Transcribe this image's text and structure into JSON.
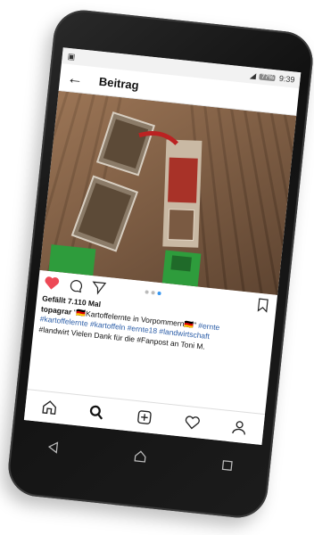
{
  "status_bar": {
    "time": "9:39",
    "battery": "77%"
  },
  "app_bar": {
    "title": "Beitrag"
  },
  "post": {
    "likes": "Gefällt 7.110 Mal",
    "username": "topagrar",
    "caption": "\"🇩🇪Kartoffelernte in Vorpommern🇩🇪\" ",
    "hashtags_line1": "#ernte",
    "hashtags_line2": "#kartoffelernte #kartoffeln #ernte18 #landwirtschaft",
    "caption_line3": "#landwirt Vielen Dank für die #Fanpost an Toni M."
  },
  "icons": [
    "heart-icon",
    "comment-icon",
    "send-icon",
    "bookmark-icon",
    "home-icon",
    "search-icon",
    "add-icon",
    "activity-icon",
    "profile-icon",
    "back-icon",
    "home-nav-icon",
    "recents-icon"
  ],
  "colors": {
    "like": "#ed4956",
    "hashtag": "#2c5ea8",
    "active_dot": "#3897f0"
  }
}
